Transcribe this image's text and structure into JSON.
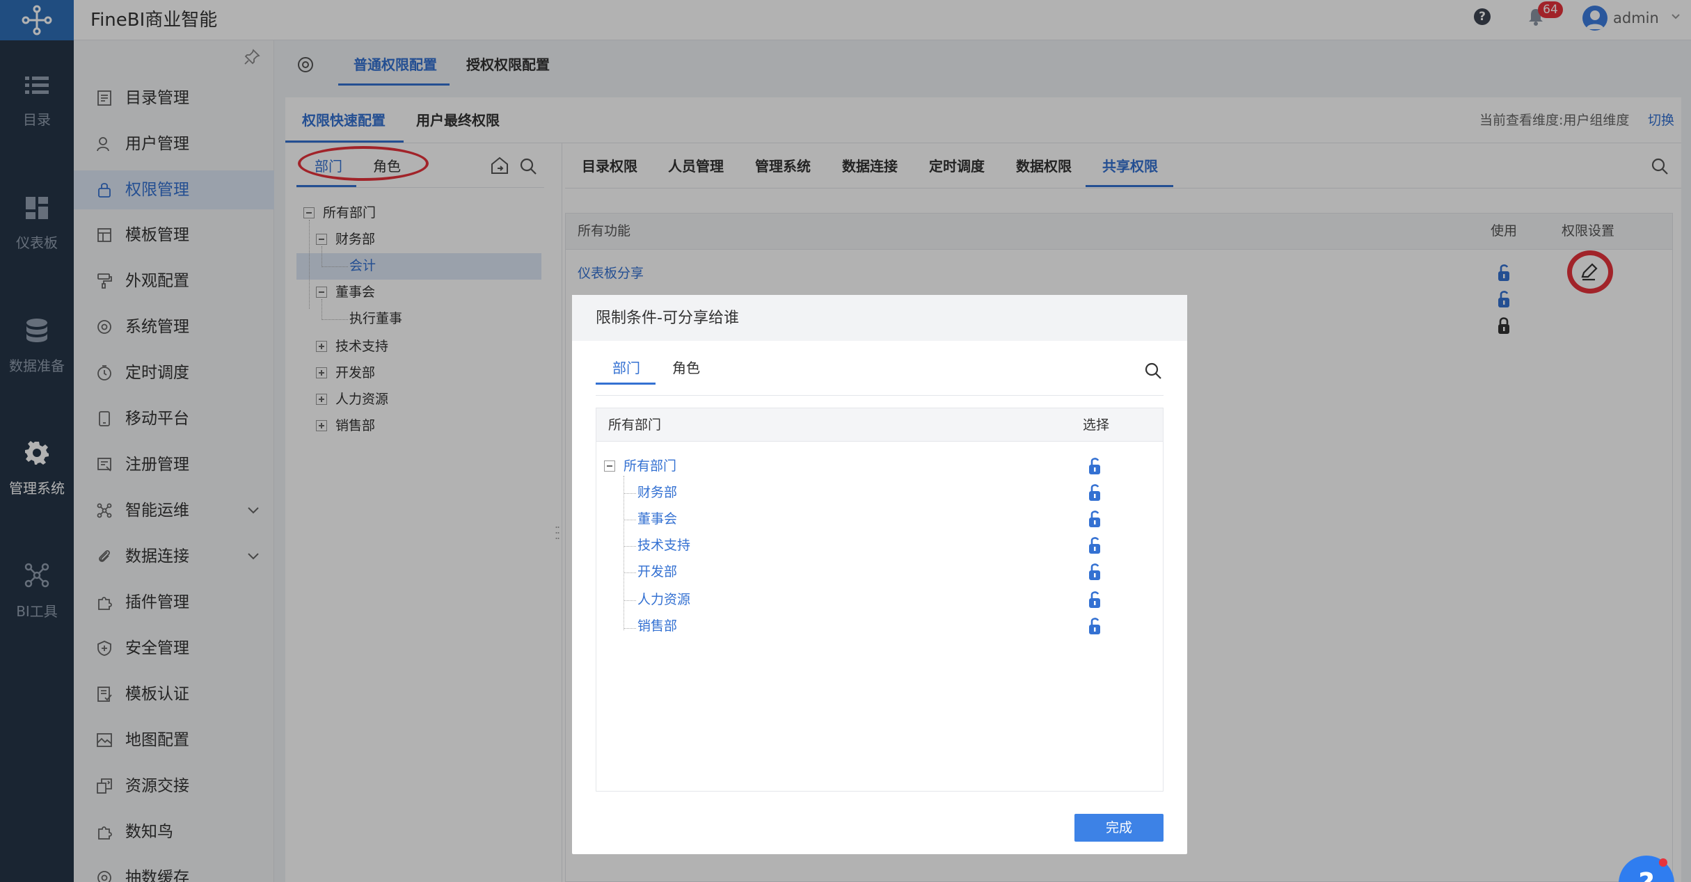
{
  "header": {
    "app_title": "FineBI商业智能",
    "notification_count": "64",
    "user_name": "admin"
  },
  "rail": {
    "items": [
      {
        "label": "目录",
        "icon": "list-icon"
      },
      {
        "label": "仪表板",
        "icon": "dashboard-icon"
      },
      {
        "label": "数据准备",
        "icon": "database-icon"
      },
      {
        "label": "管理系统",
        "icon": "gear-icon"
      },
      {
        "label": "BI工具",
        "icon": "network-icon"
      }
    ],
    "active": "管理系统"
  },
  "sidebar": {
    "items": [
      {
        "label": "目录管理"
      },
      {
        "label": "用户管理"
      },
      {
        "label": "权限管理"
      },
      {
        "label": "模板管理"
      },
      {
        "label": "外观配置"
      },
      {
        "label": "系统管理"
      },
      {
        "label": "定时调度"
      },
      {
        "label": "移动平台"
      },
      {
        "label": "注册管理"
      },
      {
        "label": "智能运维"
      },
      {
        "label": "数据连接"
      },
      {
        "label": "插件管理"
      },
      {
        "label": "安全管理"
      },
      {
        "label": "模板认证"
      },
      {
        "label": "地图配置"
      },
      {
        "label": "资源交接"
      },
      {
        "label": "数知鸟"
      },
      {
        "label": "抽数缓存"
      }
    ],
    "active_index": 2
  },
  "top_tabs": {
    "normal": "普通权限配置",
    "grant": "授权权限配置"
  },
  "sub_tabs": {
    "quick": "权限快速配置",
    "final": "用户最终权限",
    "dimension_label": "当前查看维度:用户组维度",
    "switch_label": "切换"
  },
  "tree": {
    "tabs": {
      "dept": "部门",
      "role": "角色"
    },
    "nodes": {
      "root": "所有部门",
      "finance": "财务部",
      "accounting": "会计",
      "board": "董事会",
      "exec": "执行董事",
      "tech": "技术支持",
      "dev": "开发部",
      "hr": "人力资源",
      "sales": "销售部"
    }
  },
  "perm_tabs": {
    "items": [
      "目录权限",
      "人员管理",
      "管理系统",
      "数据连接",
      "定时调度",
      "数据权限",
      "共享权限"
    ],
    "active": "共享权限"
  },
  "func_table": {
    "col_all": "所有功能",
    "col_use": "使用",
    "col_setting": "权限设置",
    "row1": "仪表板分享"
  },
  "dialog": {
    "title": "限制条件-可分享给谁",
    "tabs": {
      "dept": "部门",
      "role": "角色"
    },
    "col_all": "所有部门",
    "col_select": "选择",
    "root": "所有部门",
    "children": [
      "财务部",
      "董事会",
      "技术支持",
      "开发部",
      "人力资源",
      "销售部"
    ],
    "done_label": "完成"
  },
  "help_fab": "?"
}
